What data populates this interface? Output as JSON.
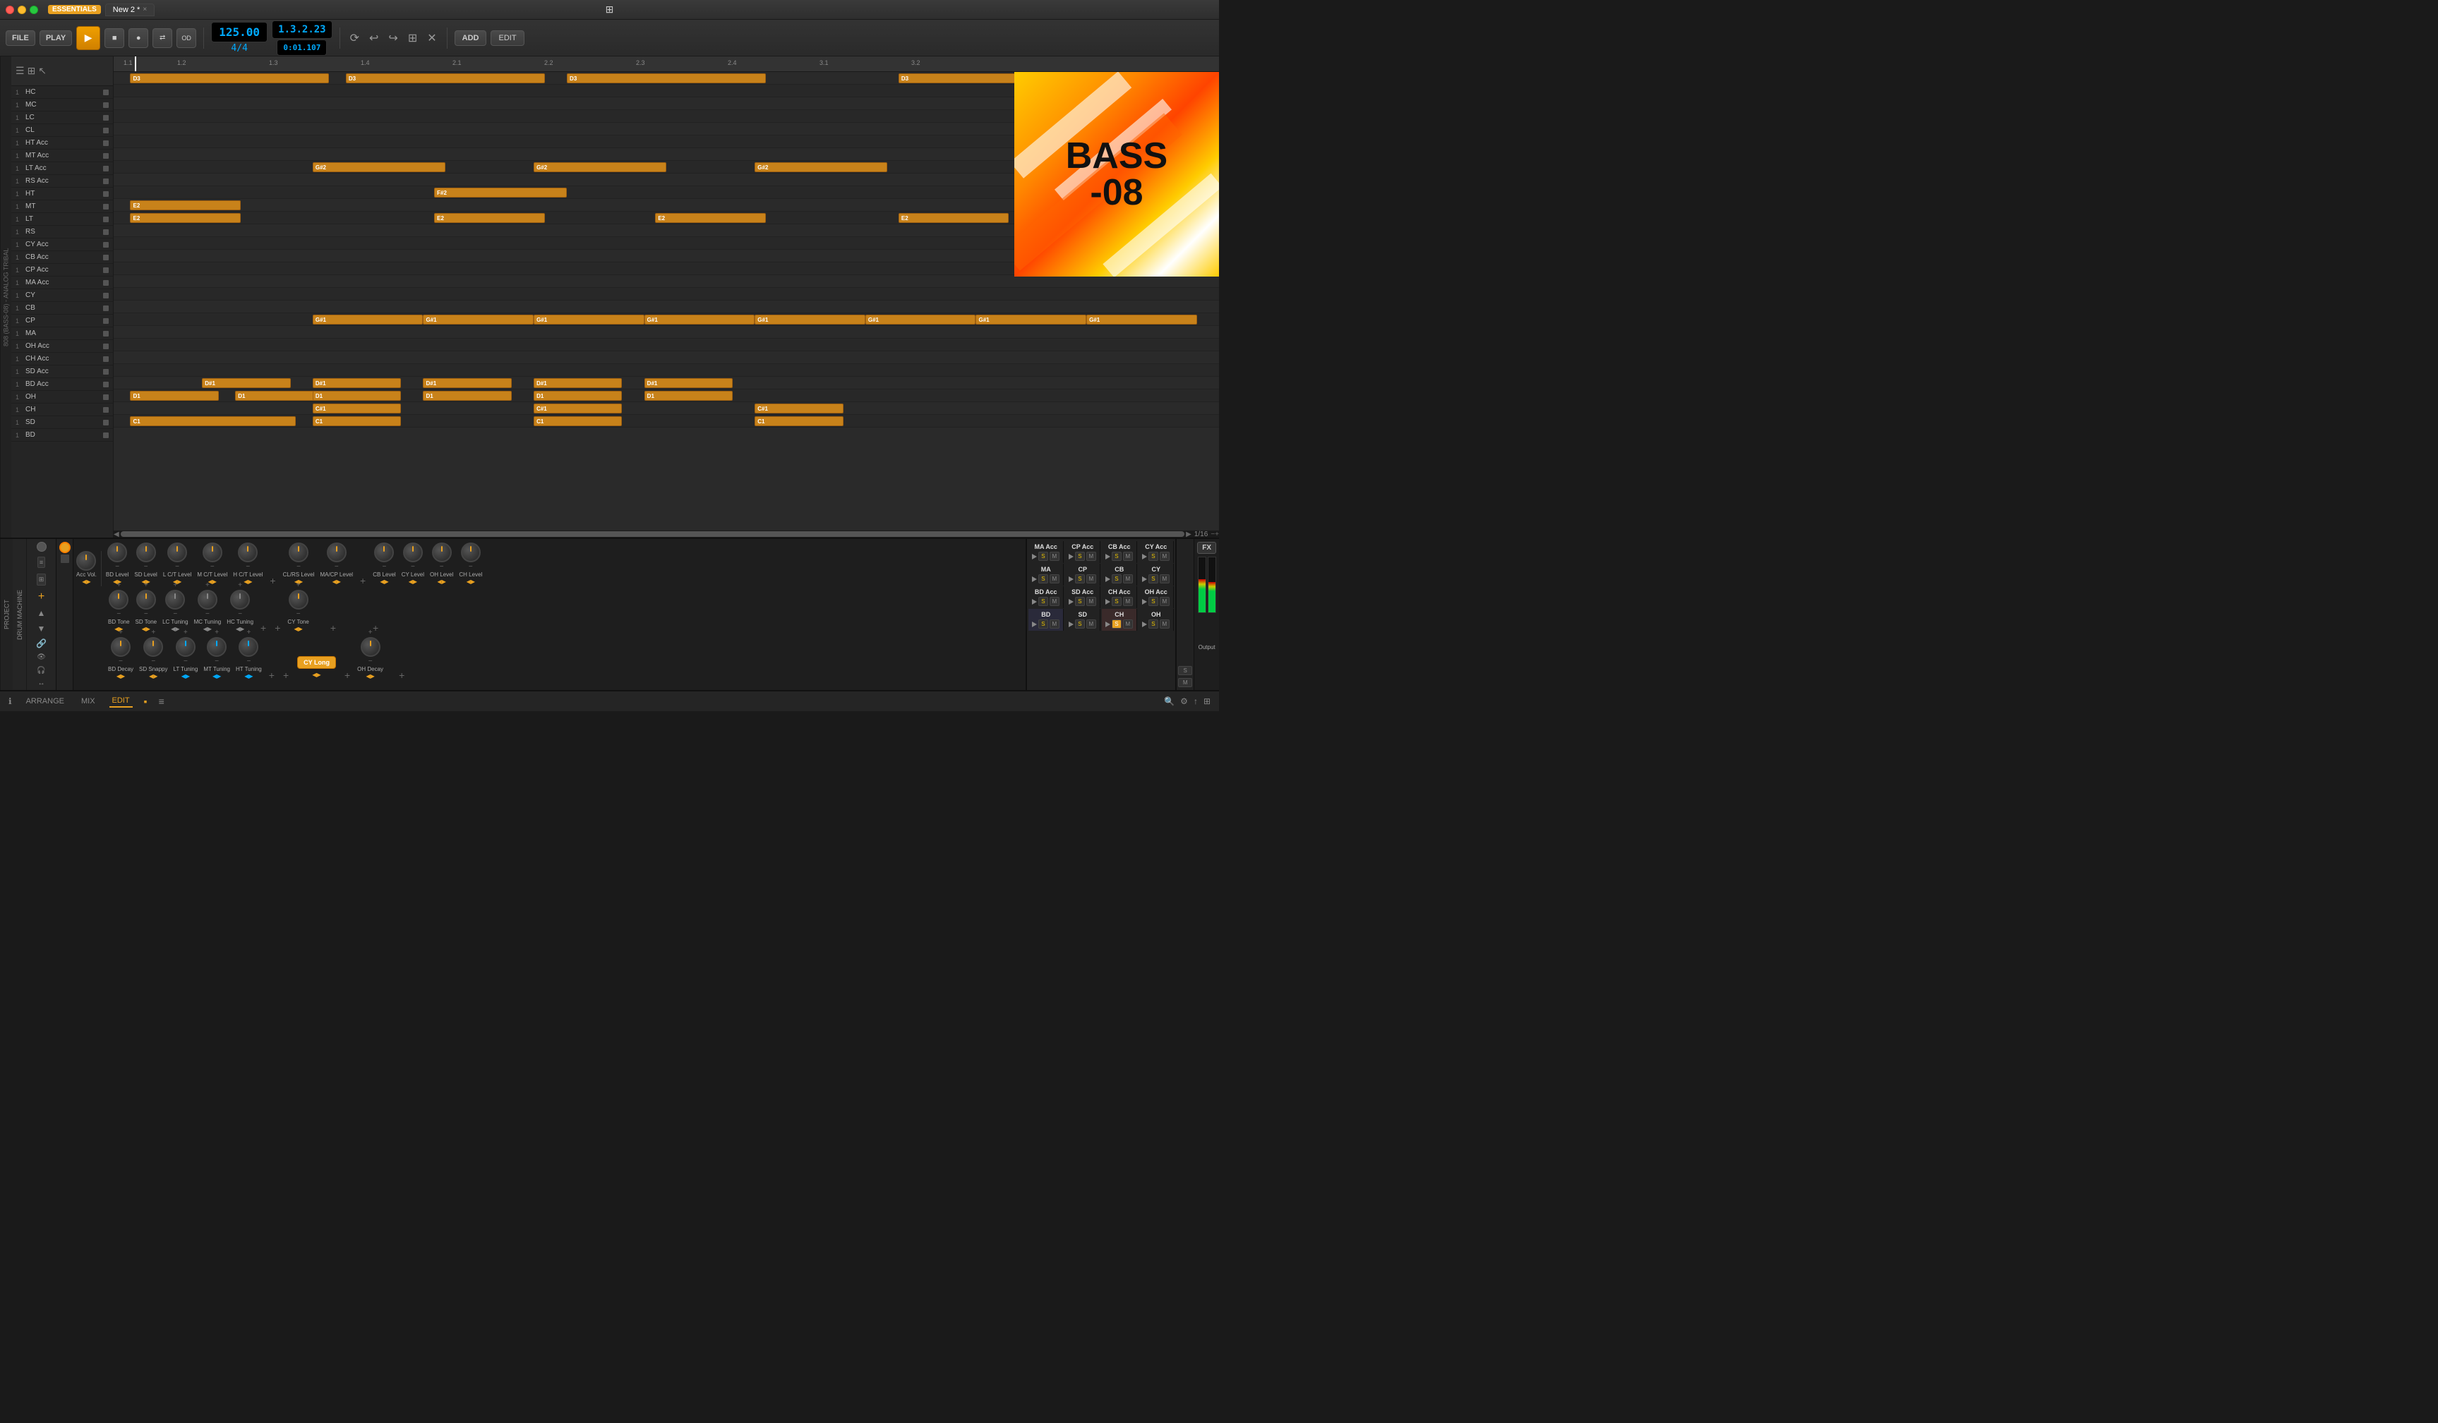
{
  "titlebar": {
    "badge": "ESSENTIALS",
    "tab_label": "New 2 *",
    "close_symbol": "×",
    "grid_icon": "⊞"
  },
  "transport": {
    "file_label": "FILE",
    "play_label": "PLAY",
    "tempo": "125.00",
    "time_sig": "4/4",
    "position": "1.3.2.23",
    "time": "0:01.107",
    "add_label": "ADD",
    "edit_label": "EDIT"
  },
  "tracks": [
    {
      "num": "1",
      "name": "HC"
    },
    {
      "num": "1",
      "name": "MC"
    },
    {
      "num": "1",
      "name": "LC"
    },
    {
      "num": "1",
      "name": "CL"
    },
    {
      "num": "1",
      "name": "HT Acc"
    },
    {
      "num": "1",
      "name": "MT Acc"
    },
    {
      "num": "1",
      "name": "LT Acc"
    },
    {
      "num": "1",
      "name": "RS Acc"
    },
    {
      "num": "1",
      "name": "HT"
    },
    {
      "num": "1",
      "name": "MT"
    },
    {
      "num": "1",
      "name": "LT"
    },
    {
      "num": "1",
      "name": "RS"
    },
    {
      "num": "1",
      "name": "CY Acc"
    },
    {
      "num": "1",
      "name": "CB Acc"
    },
    {
      "num": "1",
      "name": "CP Acc"
    },
    {
      "num": "1",
      "name": "MA Acc"
    },
    {
      "num": "1",
      "name": "CY"
    },
    {
      "num": "1",
      "name": "CB"
    },
    {
      "num": "1",
      "name": "CP"
    },
    {
      "num": "1",
      "name": "MA"
    },
    {
      "num": "1",
      "name": "OH Acc"
    },
    {
      "num": "1",
      "name": "CH Acc"
    },
    {
      "num": "1",
      "name": "SD Acc"
    },
    {
      "num": "1",
      "name": "BD Acc"
    },
    {
      "num": "1",
      "name": "OH"
    },
    {
      "num": "1",
      "name": "CH"
    },
    {
      "num": "1",
      "name": "SD"
    },
    {
      "num": "1",
      "name": "BD"
    }
  ],
  "timeline_markers": [
    "1.1",
    "1.4",
    "1.4",
    "2.1",
    "2.4",
    "3.1",
    "3.2"
  ],
  "plugin": {
    "name": "BASS-08",
    "line1": "BASS",
    "line2": "-08"
  },
  "drum_machine": {
    "label": "DRUM MACHINE",
    "knobs": [
      {
        "label": "Acc Vol.",
        "type": "orange"
      },
      {
        "label": "BD Level",
        "type": "orange"
      },
      {
        "label": "SD Level",
        "type": "orange"
      },
      {
        "label": "L C/T Level",
        "type": "orange"
      },
      {
        "label": "M C/T Level",
        "type": "orange"
      },
      {
        "label": "H C/T Level",
        "type": "orange"
      },
      {
        "label": "CL/RS Level",
        "type": "orange"
      },
      {
        "label": "MA/CP Level",
        "type": "orange"
      },
      {
        "label": "CB Level",
        "type": "orange"
      },
      {
        "label": "CY Level",
        "type": "orange"
      },
      {
        "label": "OH Level",
        "type": "orange"
      },
      {
        "label": "CH Level",
        "type": "orange"
      }
    ],
    "knobs_row2": [
      {
        "label": "BD Tone",
        "type": "orange"
      },
      {
        "label": "SD Tone",
        "type": "orange"
      },
      {
        "label": "LC Tuning",
        "type": "gray"
      },
      {
        "label": "MC Tuning",
        "type": "gray"
      },
      {
        "label": "HC Tuning",
        "type": "gray"
      },
      {
        "label": "CY Tone",
        "type": "orange"
      }
    ],
    "knobs_row3": [
      {
        "label": "BD Decay",
        "type": "orange"
      },
      {
        "label": "SD Snappy",
        "type": "orange"
      },
      {
        "label": "LT Tuning",
        "type": "blue"
      },
      {
        "label": "MT Tuning",
        "type": "blue"
      },
      {
        "label": "HT Tuning",
        "type": "blue"
      },
      {
        "label": "OH Decay",
        "type": "orange"
      }
    ],
    "cy_long_label": "CY Long",
    "send_channels": [
      {
        "name": "MA Acc"
      },
      {
        "name": "CP Acc"
      },
      {
        "name": "CB Acc"
      },
      {
        "name": "CY Acc"
      },
      {
        "name": "MA"
      },
      {
        "name": "CP"
      },
      {
        "name": "CB"
      },
      {
        "name": "CY"
      },
      {
        "name": "BD Acc"
      },
      {
        "name": "SD Acc"
      },
      {
        "name": "CH Acc"
      },
      {
        "name": "OH Acc"
      },
      {
        "name": "BD"
      },
      {
        "name": "SD"
      },
      {
        "name": "CH"
      },
      {
        "name": "OH"
      }
    ],
    "fx_label": "FX",
    "output_label": "Output"
  },
  "bottom_nav": {
    "arrange_label": "ARRANGE",
    "mix_label": "MIX",
    "edit_label": "EDIT"
  },
  "zoom_label": "1/16"
}
